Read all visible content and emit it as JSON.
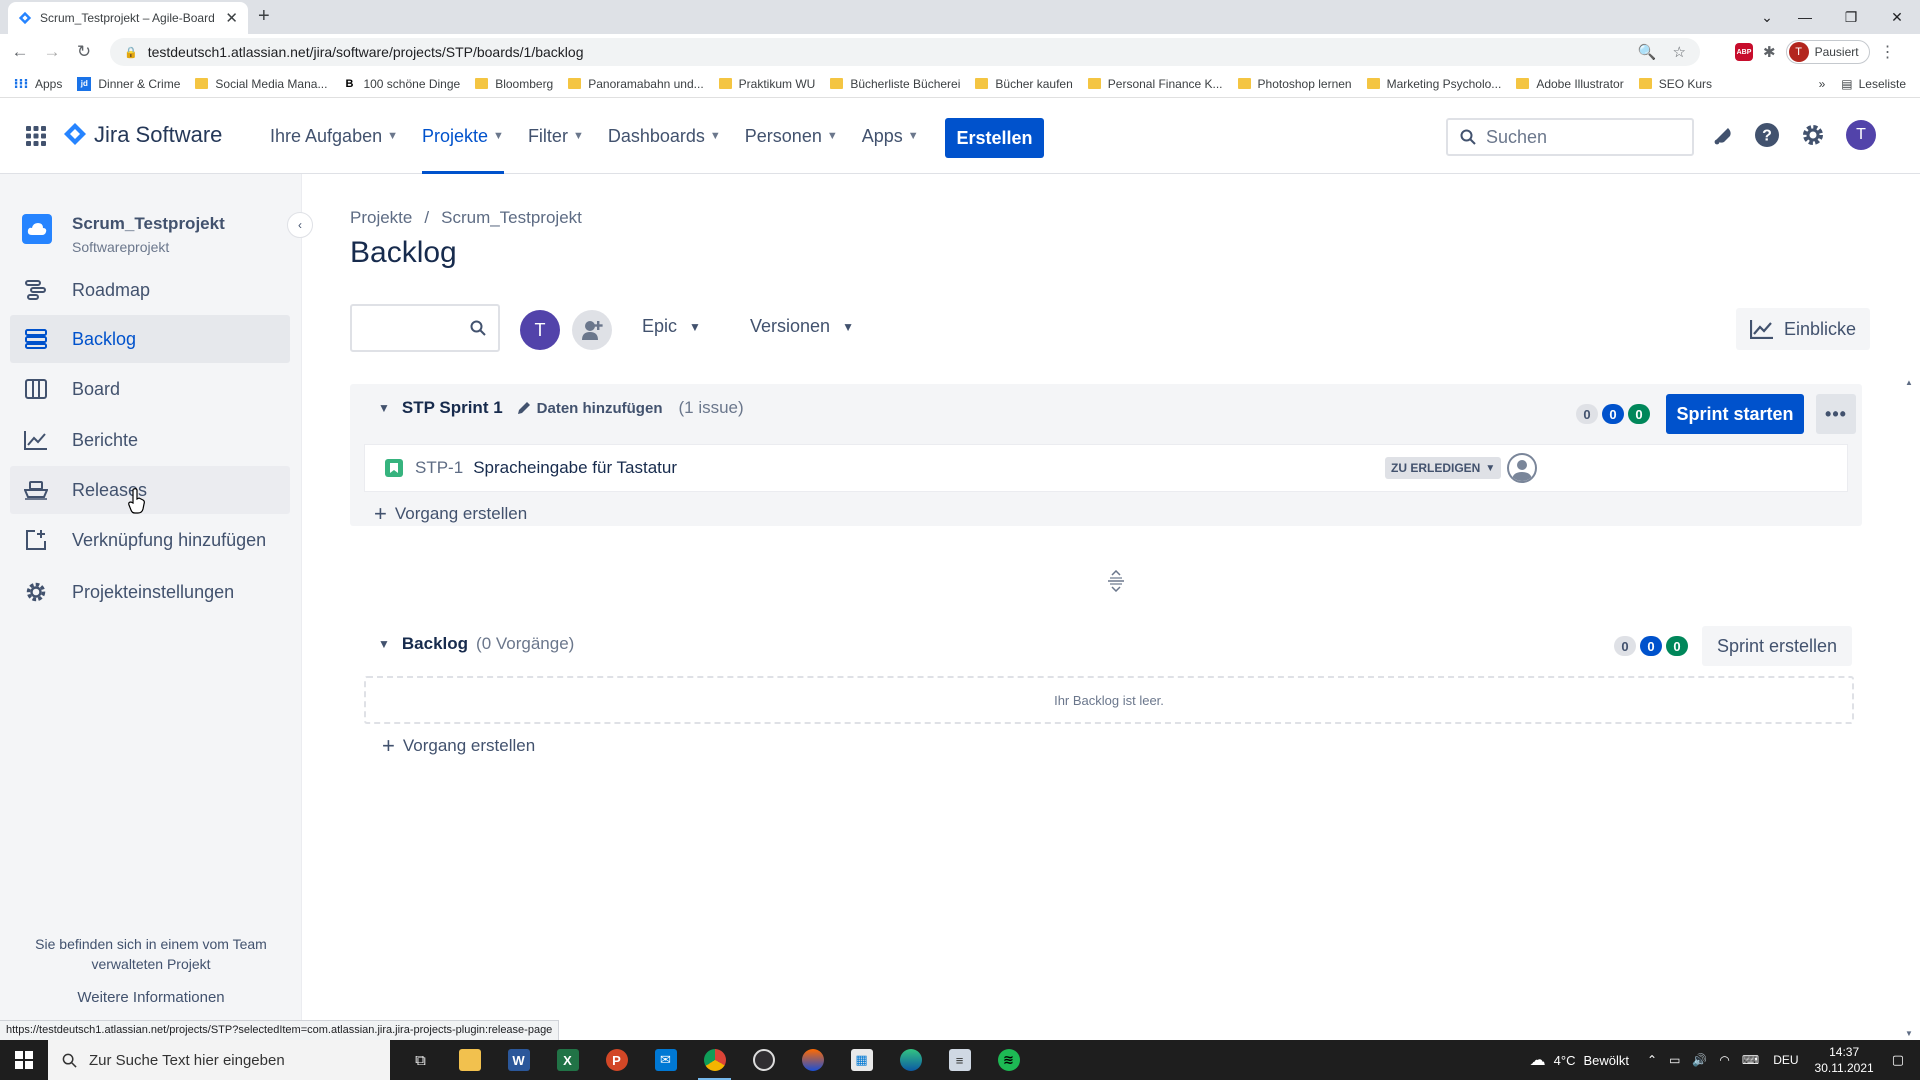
{
  "browser": {
    "tab_title": "Scrum_Testprojekt – Agile-Board",
    "url": "testdeutsch1.atlassian.net/jira/software/projects/STP/boards/1/backlog",
    "profile_label": "Pausiert",
    "profile_initial": "T",
    "bookmarks": [
      {
        "label": "Apps",
        "icon": "grid"
      },
      {
        "label": "Dinner & Crime",
        "icon": "jd"
      },
      {
        "label": "Social Media Mana...",
        "icon": "folder"
      },
      {
        "label": "100 schöne Dinge",
        "icon": "B"
      },
      {
        "label": "Bloomberg",
        "icon": "folder"
      },
      {
        "label": "Panoramabahn und...",
        "icon": "folder"
      },
      {
        "label": "Praktikum WU",
        "icon": "folder"
      },
      {
        "label": "Bücherliste Bücherei",
        "icon": "folder"
      },
      {
        "label": "Bücher kaufen",
        "icon": "folder"
      },
      {
        "label": "Personal Finance K...",
        "icon": "folder"
      },
      {
        "label": "Photoshop lernen",
        "icon": "folder"
      },
      {
        "label": "Marketing Psycholo...",
        "icon": "folder"
      },
      {
        "label": "Adobe Illustrator",
        "icon": "folder"
      },
      {
        "label": "SEO Kurs",
        "icon": "folder"
      }
    ],
    "more_bookmarks": "»",
    "reading_list": "Leseliste",
    "status_url": "https://testdeutsch1.atlassian.net/projects/STP?selectedItem=com.atlassian.jira.jira-projects-plugin:release-page"
  },
  "jira_nav": {
    "product": "Jira Software",
    "items": [
      {
        "label": "Ihre Aufgaben",
        "active": false
      },
      {
        "label": "Projekte",
        "active": true
      },
      {
        "label": "Filter",
        "active": false
      },
      {
        "label": "Dashboards",
        "active": false
      },
      {
        "label": "Personen",
        "active": false
      },
      {
        "label": "Apps",
        "active": false
      }
    ],
    "create_label": "Erstellen",
    "search_placeholder": "Suchen",
    "user_initial": "T",
    "brand_color": "#0052cc"
  },
  "sidebar": {
    "project_name": "Scrum_Testprojekt",
    "project_type": "Softwareprojekt",
    "items": [
      {
        "label": "Roadmap",
        "icon": "roadmap-icon"
      },
      {
        "label": "Backlog",
        "icon": "backlog-icon"
      },
      {
        "label": "Board",
        "icon": "board-icon"
      },
      {
        "label": "Berichte",
        "icon": "reports-icon"
      },
      {
        "label": "Releases",
        "icon": "ship-icon"
      },
      {
        "label": "Verknüpfung hinzufügen",
        "icon": "add-shortcut-icon"
      },
      {
        "label": "Projekteinstellungen",
        "icon": "gear-icon"
      }
    ],
    "footer_text": "Sie befinden sich in einem vom Team verwalteten Projekt",
    "footer_link": "Weitere Informationen"
  },
  "main": {
    "breadcrumb": [
      "Projekte",
      "Scrum_Testprojekt"
    ],
    "breadcrumb_sep": "/",
    "title": "Backlog",
    "filter_avatar": "T",
    "epic_label": "Epic",
    "versions_label": "Versionen",
    "insights_label": "Einblicke",
    "sprint": {
      "name": "STP Sprint 1",
      "add_dates": "Daten hinzufügen",
      "issue_count": "(1 issue)",
      "counts": [
        "0",
        "0",
        "0"
      ],
      "start_label": "Sprint starten",
      "more_label": "•••",
      "issues": [
        {
          "key": "STP-1",
          "summary": "Spracheingabe für Tastatur",
          "status": "ZU ERLEDIGEN"
        }
      ],
      "create_issue": "Vorgang erstellen"
    },
    "backlog": {
      "name": "Backlog",
      "count": "(0 Vorgänge)",
      "counts": [
        "0",
        "0",
        "0"
      ],
      "create_sprint": "Sprint erstellen",
      "empty_text": "Ihr Backlog ist leer.",
      "create_issue": "Vorgang erstellen"
    }
  },
  "taskbar": {
    "search_placeholder": "Zur Suche Text hier eingeben",
    "weather_temp": "4°C",
    "weather_text": "Bewölkt",
    "language": "DEU",
    "time": "14:37",
    "date": "30.11.2021"
  }
}
